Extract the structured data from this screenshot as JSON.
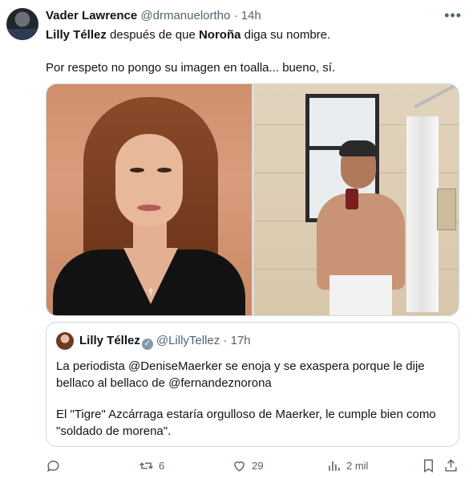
{
  "tweet": {
    "author_name": "Vader Lawrence",
    "author_handle": "@drmanuelortho",
    "separator": "·",
    "time": "14h",
    "more_icon": "more-icon",
    "line1_bold1": "Lilly Téllez",
    "line1_mid": " después de que ",
    "line1_bold2": "Noroña",
    "line1_end": " diga su nombre.",
    "line2": "Por respeto no pongo su imagen en toalla...  bueno, sí."
  },
  "quote": {
    "author_name": "Lilly Téllez",
    "verified_icon": "verified-badge-icon",
    "author_handle": "@LillyTellez",
    "separator": "·",
    "time": "17h",
    "line1": "La periodista @DeniseMaerker se enoja y se exaspera porque le dije",
    "line2": "bellaco al bellaco de @fernandeznorona",
    "line3": "El \"Tigre\" Azcárraga estaría orgulloso de Maerker, le cumple bien como",
    "line4": "\"soldado de morena\"."
  },
  "actions": {
    "reply_count": "",
    "retweet_count": "6",
    "like_count": "29",
    "views_count": "2 mil"
  }
}
